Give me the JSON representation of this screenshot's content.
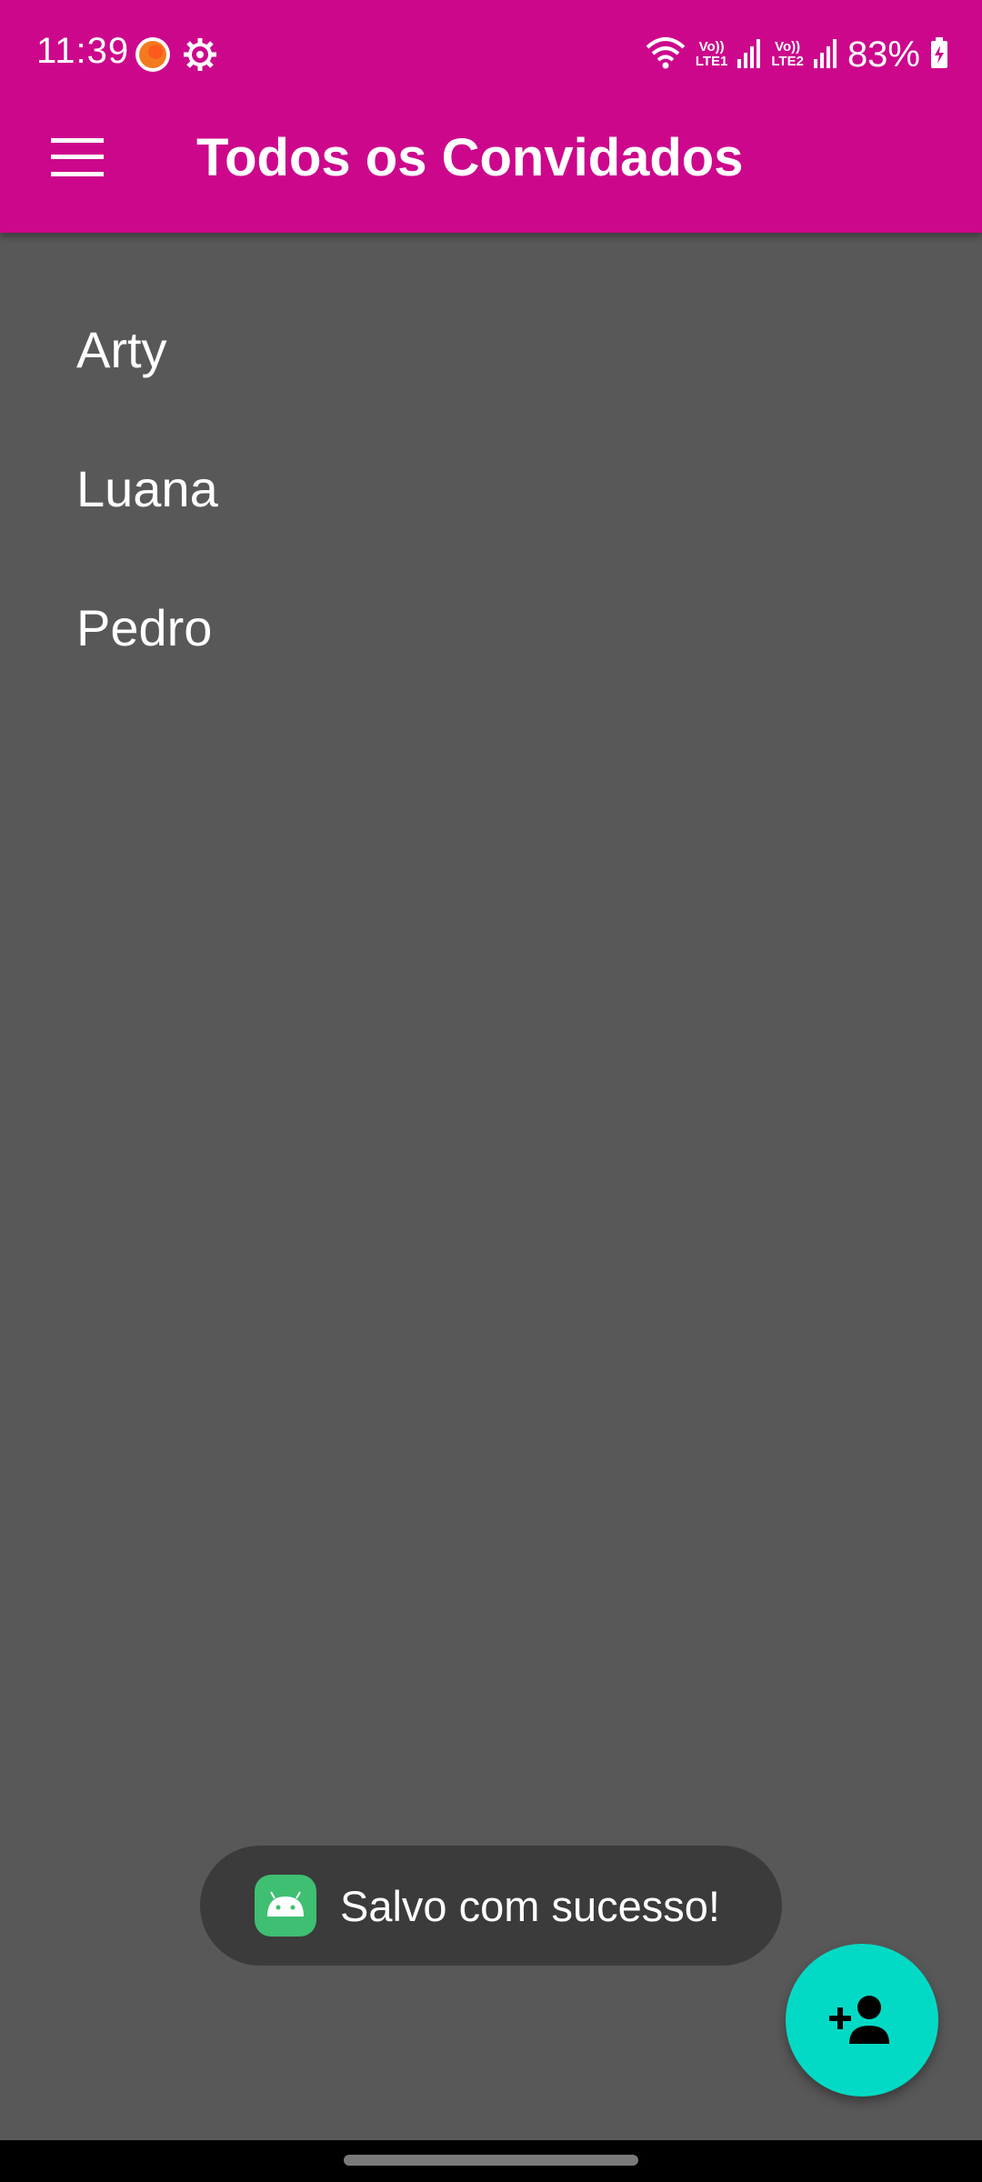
{
  "status_bar": {
    "time": "11:39",
    "sim1_label_top": "Vo))",
    "sim1_label_bottom": "LTE1",
    "sim2_label_top": "Vo))",
    "sim2_label_bottom": "LTE2",
    "battery_percent": "83%",
    "icons": [
      "notification-app-icon",
      "settings-gear-icon",
      "wifi-icon",
      "signal-icon",
      "signal-icon",
      "battery-charging-icon"
    ]
  },
  "toolbar": {
    "title": "Todos os Convidados",
    "menu_icon": "hamburger-menu-icon"
  },
  "guests": [
    {
      "name": "Arty"
    },
    {
      "name": "Luana"
    },
    {
      "name": "Pedro"
    }
  ],
  "toast": {
    "message": "Salvo com sucesso!",
    "icon": "android-app-icon"
  },
  "fab": {
    "icon": "add-person-icon"
  },
  "colors": {
    "app_bar": "#cc078c",
    "background": "#595859",
    "fab": "#03dac5",
    "toast_bg": "#3b3b3b"
  }
}
